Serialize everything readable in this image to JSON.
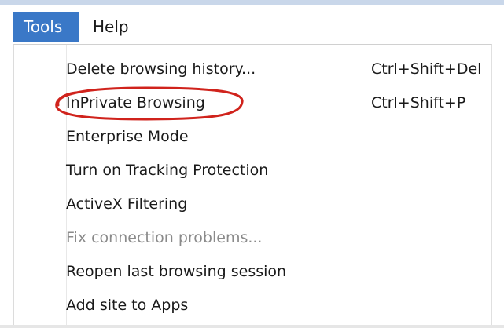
{
  "menubar": {
    "tools_label": "Tools",
    "help_label": "Help"
  },
  "dropdown": {
    "items": [
      {
        "label": "Delete browsing history...",
        "shortcut": "Ctrl+Shift+Del",
        "enabled": true
      },
      {
        "label": "InPrivate Browsing",
        "shortcut": "Ctrl+Shift+P",
        "enabled": true
      },
      {
        "label": "Enterprise Mode",
        "shortcut": "",
        "enabled": true
      },
      {
        "label": "Turn on Tracking Protection",
        "shortcut": "",
        "enabled": true
      },
      {
        "label": "ActiveX Filtering",
        "shortcut": "",
        "enabled": true
      },
      {
        "label": "Fix connection problems...",
        "shortcut": "",
        "enabled": false
      },
      {
        "label": "Reopen last browsing session",
        "shortcut": "",
        "enabled": true
      },
      {
        "label": "Add site to Apps",
        "shortcut": "",
        "enabled": true
      }
    ]
  },
  "colors": {
    "menubar_active_bg": "#3a78c7",
    "annotation_stroke": "#d0231c",
    "disabled_text": "#8a8a8a"
  }
}
